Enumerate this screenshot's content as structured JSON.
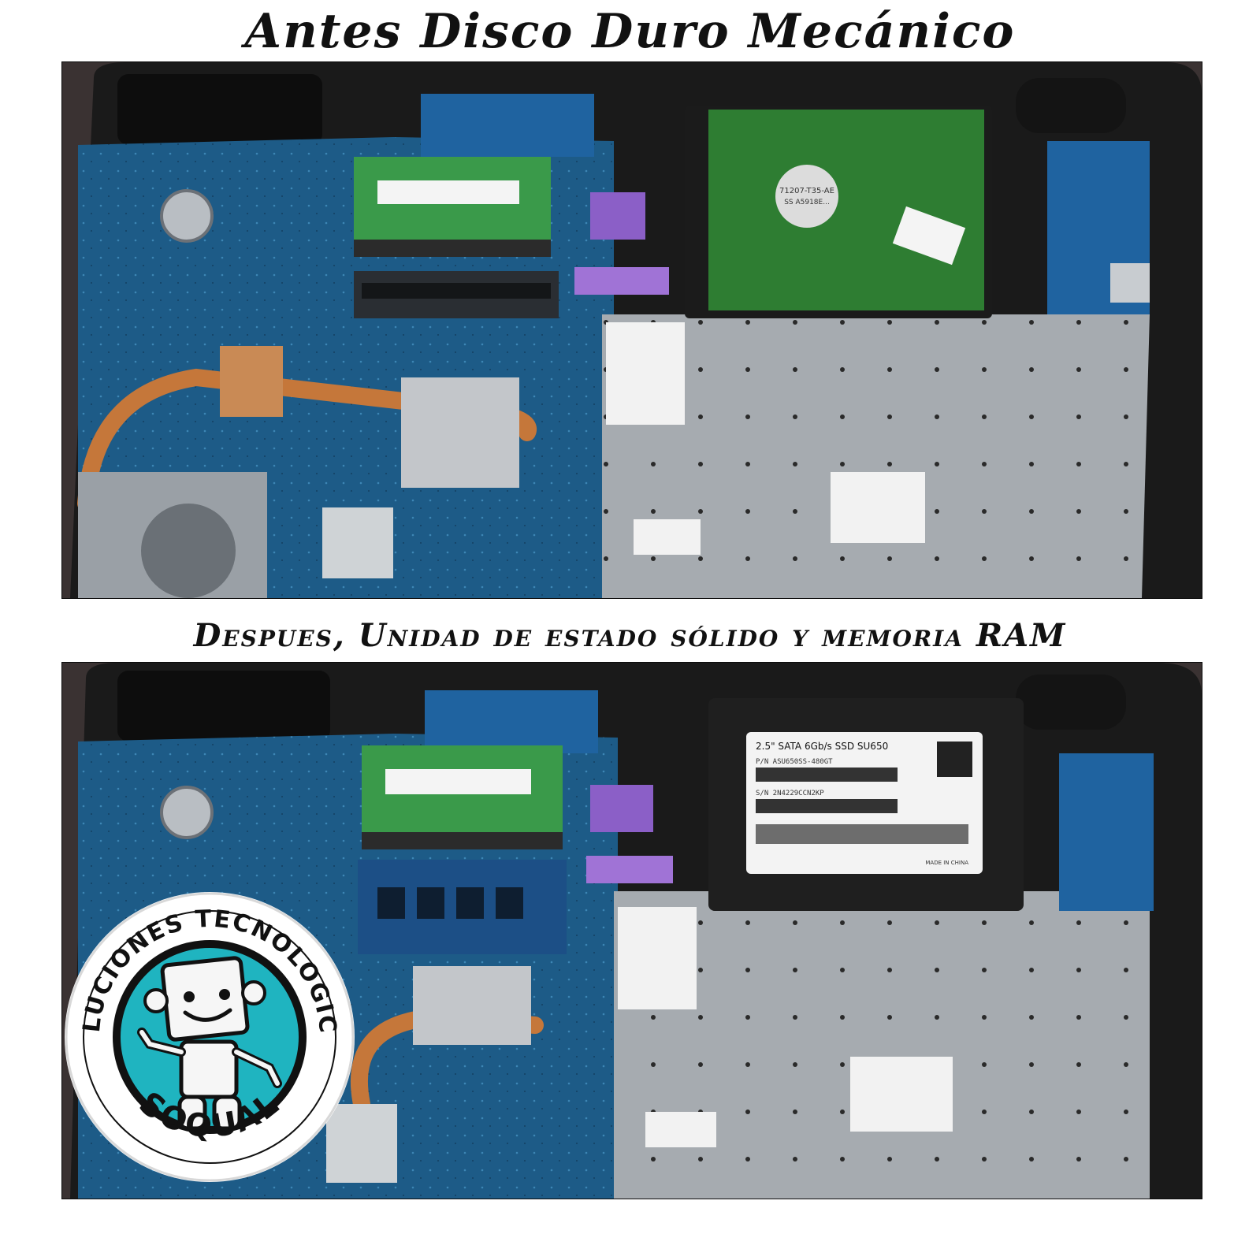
{
  "title_top": "Antes Disco Duro Mecánico",
  "title_bottom": "Despues, Unidad de estado sólido y memoria RAM",
  "before": {
    "hdd_label_1": "71207-T35-AE",
    "hdd_label_2": "SS A5918E..."
  },
  "after": {
    "ssd_model": "2.5\" SATA 6Gb/s SSD SU650",
    "ssd_pn": "P/N  ASU650SS-480GT",
    "ssd_sn": "S/N  2N4229CCN2KP",
    "ssd_origin": "MADE IN CHINA"
  },
  "logo": {
    "arc_text": "SOLUCIONES TECNOLOGICAS",
    "brand": "SOQUAL",
    "colors": {
      "ring": "#111111",
      "inner": "#1fb4c0",
      "text": "#111111"
    }
  },
  "colors": {
    "board": "#1c5f8c",
    "chassis": "#a9aeb3",
    "hdd_pcb": "#2e7d32",
    "copper": "#c5773a",
    "ram": "#3a9a4a"
  }
}
